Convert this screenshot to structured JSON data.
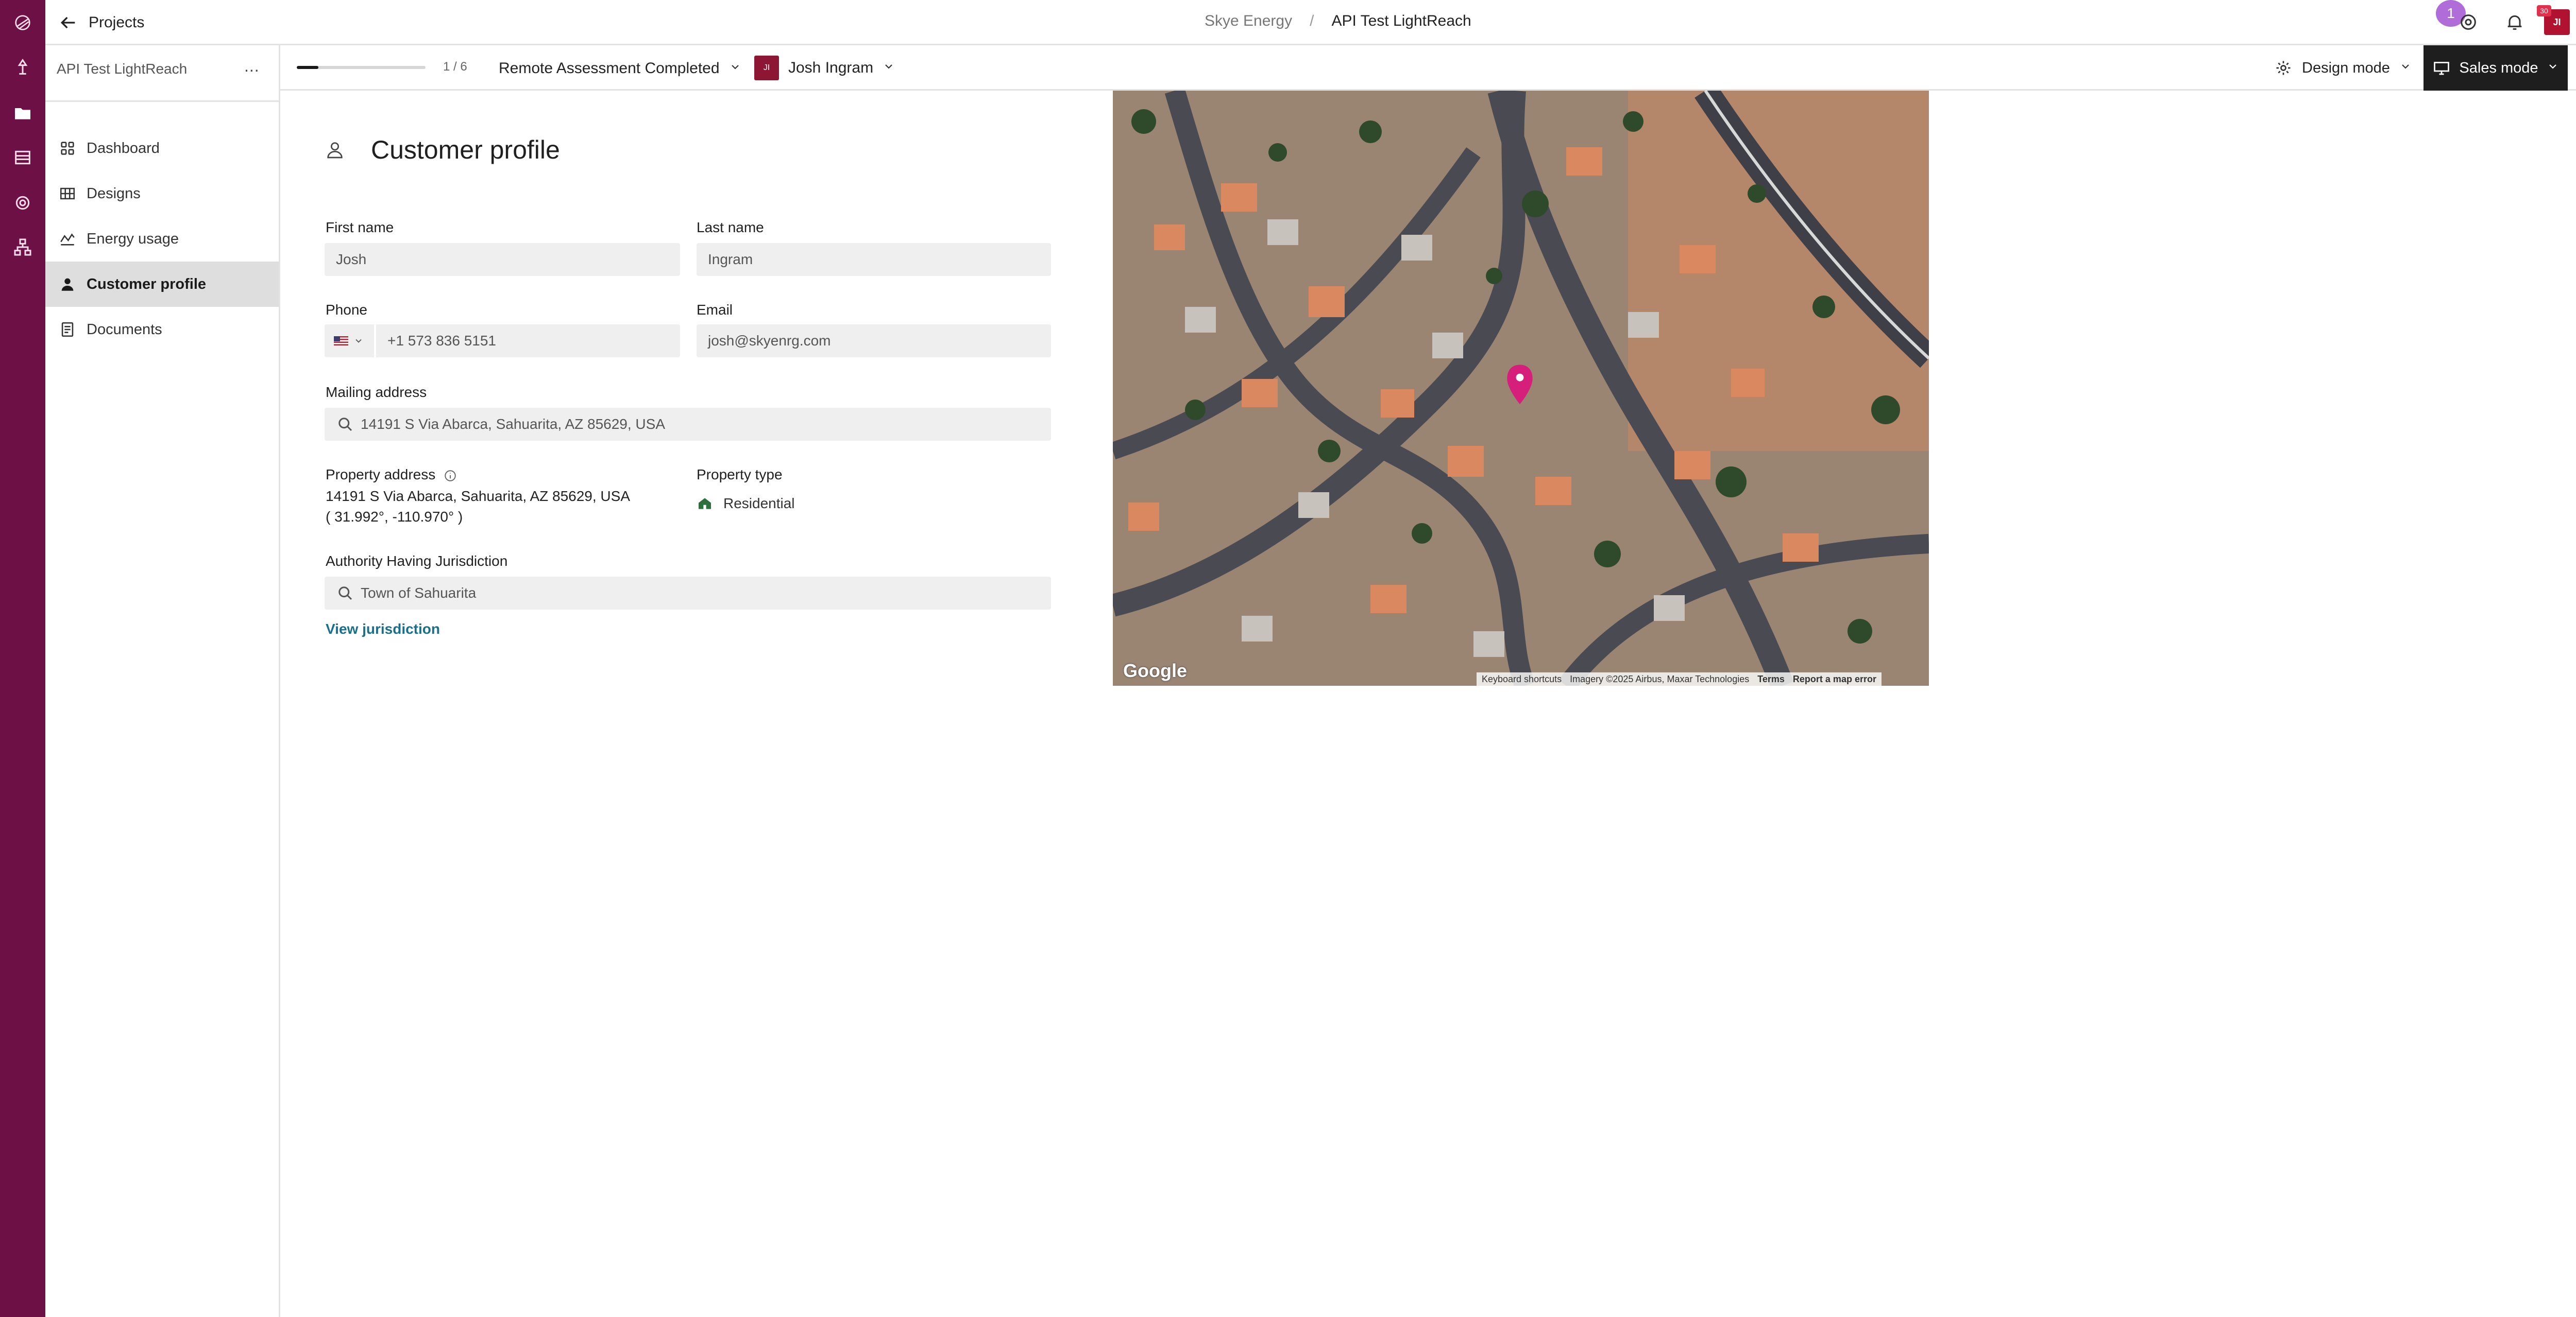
{
  "header": {
    "back_label": "Projects",
    "org": "Skye Energy",
    "separator": "/",
    "project": "API Test LightReach",
    "badge_count": "1",
    "avatar_initials": "JI",
    "avatar_dot": "30"
  },
  "sidebar": {
    "title": "API Test LightReach",
    "more": "...",
    "items": [
      {
        "label": "Dashboard",
        "icon": "dashboard-icon"
      },
      {
        "label": "Designs",
        "icon": "designs-icon"
      },
      {
        "label": "Energy usage",
        "icon": "energy-icon"
      },
      {
        "label": "Customer profile",
        "icon": "person-icon",
        "active": true
      },
      {
        "label": "Documents",
        "icon": "document-icon"
      }
    ]
  },
  "toolbar": {
    "progress_fraction": 0.1667,
    "progress_label": "1 / 6",
    "status": "Remote Assessment Completed",
    "owner_name": "Josh Ingram",
    "owner_initials": "JI",
    "design_mode": "Design mode",
    "sales_mode": "Sales mode"
  },
  "form": {
    "title": "Customer profile",
    "first_name_label": "First name",
    "first_name": "Josh",
    "last_name_label": "Last name",
    "last_name": "Ingram",
    "phone_label": "Phone",
    "phone": "+1 573 836 5151",
    "email_label": "Email",
    "email": "josh@skyenrg.com",
    "mailing_label": "Mailing address",
    "mailing_address": "14191 S Via Abarca, Sahuarita, AZ 85629, USA",
    "property_address_label": "Property address",
    "property_address": "14191 S Via Abarca, Sahuarita, AZ 85629, USA",
    "property_coords": "( 31.992°, -110.970° )",
    "property_type_label": "Property type",
    "property_type": "Residential",
    "ahj_label": "Authority Having Jurisdiction",
    "ahj": "Town of Sahuarita",
    "view_jurisdiction": "View jurisdiction"
  },
  "map": {
    "google": "Google",
    "keyboard": "Keyboard shortcuts",
    "imagery": "Imagery ©2025 Airbus, Maxar Technologies",
    "terms": "Terms",
    "report": "Report a map error",
    "pin_color": "#d61f7a"
  },
  "colors": {
    "rail": "#6d1046",
    "accent_link": "#1a6f8a",
    "sales_mode_bg": "#1e1e1e"
  }
}
